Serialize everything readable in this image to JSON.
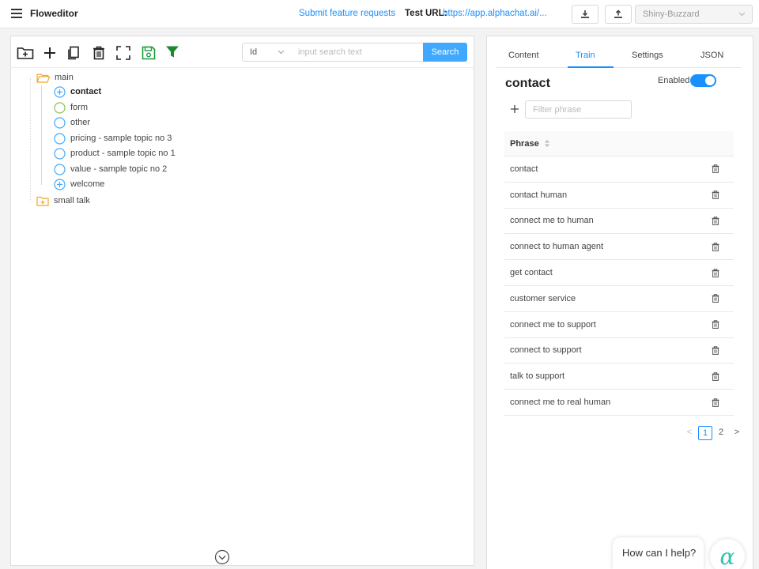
{
  "header": {
    "app_title": "Floweditor",
    "feature_link": "Submit feature requests",
    "test_url_label": "Test URL:",
    "test_url_value": "https://app.alphachat.ai/...",
    "download_icon": "download-icon",
    "upload_icon": "upload-icon",
    "bot_select_value": "Shiny-Buzzard"
  },
  "toolbar": {
    "icons": [
      "folder-add-icon",
      "plus-icon",
      "copy-icon",
      "delete-icon",
      "expand-icon",
      "save-icon",
      "filter-icon"
    ],
    "save_color": "#1a9c3e",
    "filter_color": "#1a8a2a",
    "search_field_value": "Id",
    "search_placeholder": "input search text",
    "search_button": "Search",
    "accent": "#40a9ff"
  },
  "tree": {
    "root_folder": "main",
    "children": [
      {
        "label": "contact",
        "icon": "plus-circle-icon",
        "bold": true
      },
      {
        "label": "form",
        "icon": "circle-icon-green",
        "bold": false
      },
      {
        "label": "other",
        "icon": "circle-icon",
        "bold": false
      },
      {
        "label": "pricing - sample topic no 3",
        "icon": "circle-icon",
        "bold": false
      },
      {
        "label": "product - sample topic no 1",
        "icon": "circle-icon",
        "bold": false
      },
      {
        "label": "value - sample topic no 2",
        "icon": "circle-icon",
        "bold": false
      },
      {
        "label": "welcome",
        "icon": "plus-circle-icon",
        "bold": false
      }
    ],
    "second_folder": "small talk",
    "folder_color": "#f0a830"
  },
  "right": {
    "tabs": [
      "Content",
      "Train",
      "Settings",
      "JSON"
    ],
    "active_tab": "Train",
    "topic_title": "contact",
    "enabled_label": "Enabled",
    "enabled": true,
    "filter_placeholder": "Filter phrase",
    "column_header": "Phrase",
    "phrases": [
      "contact",
      "contact human",
      "connect me to human",
      "connect to human agent",
      "get contact",
      "customer service",
      "connect me to support",
      "connect to support",
      "talk to support",
      "connect me to real human"
    ],
    "pagination": {
      "prev": "<",
      "pages": [
        "1",
        "2"
      ],
      "current": "1",
      "next": ">"
    }
  },
  "chat": {
    "bubble_text": "How can I help?",
    "launcher_glyph": "α",
    "launcher_color": "#2dc3b3"
  }
}
